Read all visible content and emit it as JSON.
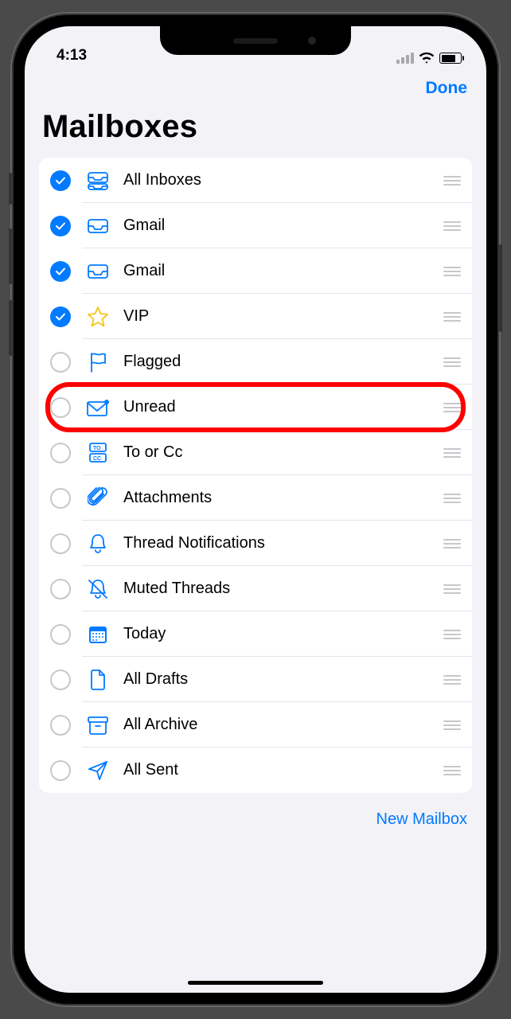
{
  "status": {
    "time": "4:13"
  },
  "nav": {
    "done": "Done"
  },
  "title": "Mailboxes",
  "toolbar": {
    "new_mailbox": "New Mailbox"
  },
  "highlighted_index": 5,
  "mailboxes": [
    {
      "label": "All Inboxes",
      "checked": true,
      "icon": "all-inboxes"
    },
    {
      "label": "Gmail",
      "checked": true,
      "icon": "inbox"
    },
    {
      "label": "Gmail",
      "checked": true,
      "icon": "inbox"
    },
    {
      "label": "VIP",
      "checked": true,
      "icon": "star"
    },
    {
      "label": "Flagged",
      "checked": false,
      "icon": "flag"
    },
    {
      "label": "Unread",
      "checked": false,
      "icon": "unread"
    },
    {
      "label": "To or Cc",
      "checked": false,
      "icon": "to-cc"
    },
    {
      "label": "Attachments",
      "checked": false,
      "icon": "paperclip"
    },
    {
      "label": "Thread Notifications",
      "checked": false,
      "icon": "bell"
    },
    {
      "label": "Muted Threads",
      "checked": false,
      "icon": "bell-slash"
    },
    {
      "label": "Today",
      "checked": false,
      "icon": "calendar"
    },
    {
      "label": "All Drafts",
      "checked": false,
      "icon": "document"
    },
    {
      "label": "All Archive",
      "checked": false,
      "icon": "archive"
    },
    {
      "label": "All Sent",
      "checked": false,
      "icon": "send"
    }
  ]
}
